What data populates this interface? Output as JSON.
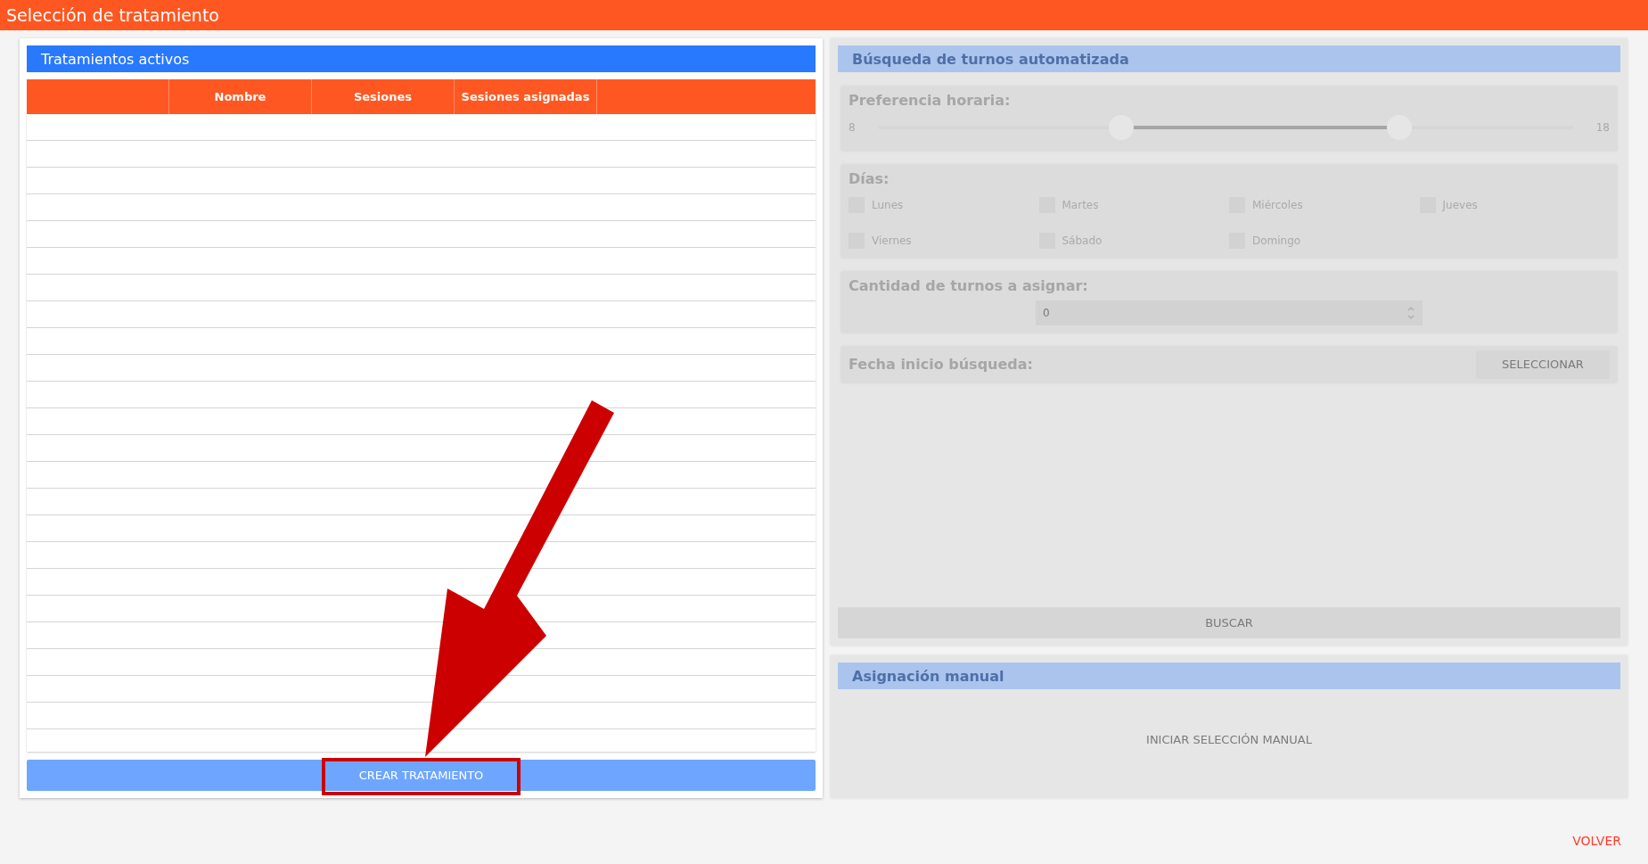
{
  "title_bar": {
    "title": "Selección de tratamiento"
  },
  "treatments": {
    "title": "Tratamientos activos",
    "columns": [
      {
        "kind": "blank"
      },
      {
        "kind": "text",
        "label": "Nombre"
      },
      {
        "kind": "text",
        "label": "Sesiones"
      },
      {
        "kind": "text",
        "label": "Sesiones asignadas"
      },
      {
        "kind": "blank"
      }
    ],
    "create_button": "CREAR TRATAMIENTO"
  },
  "auto_search": {
    "title": "Búsqueda de turnos automatizada",
    "disabled": true,
    "time_preference": {
      "label": "Preferencia horaria:",
      "min": "8",
      "max": "18",
      "thumbs": [
        {
          "level": 0.35
        },
        {
          "level": 0.75
        }
      ]
    },
    "days": {
      "label": "Días:",
      "items": [
        {
          "label": "Lunes",
          "checked": false
        },
        {
          "label": "Martes",
          "checked": false
        },
        {
          "label": "Miércoles",
          "checked": false
        },
        {
          "label": "Jueves",
          "checked": false
        },
        {
          "label": "Viernes",
          "checked": false
        },
        {
          "label": "Sábado",
          "checked": false
        },
        {
          "label": "Domingo",
          "checked": false
        }
      ]
    },
    "count": {
      "label": "Cantidad de turnos a asignar:",
      "value": "0"
    },
    "start_date": {
      "label": "Fecha inicio búsqueda:",
      "button": "SELECCIONAR"
    },
    "search_button": "BUSCAR"
  },
  "manual": {
    "title": "Asignación manual",
    "disabled": true,
    "button": "INICIAR SELECCIÓN MANUAL"
  },
  "back_link": "VOLVER"
}
